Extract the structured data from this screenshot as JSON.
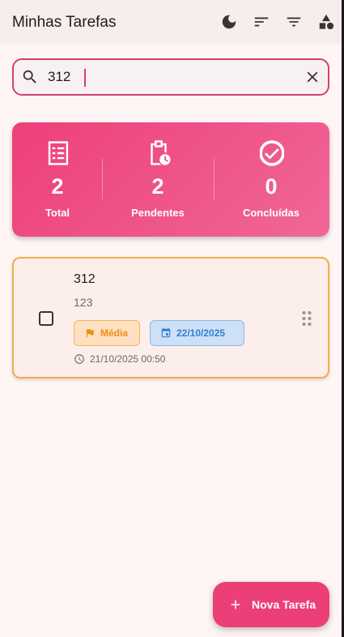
{
  "app": {
    "title": "Minhas Tarefas"
  },
  "appbar_actions": [
    {
      "icon": "dark-mode-icon"
    },
    {
      "icon": "sort-icon"
    },
    {
      "icon": "filter-icon"
    },
    {
      "icon": "category-icon"
    }
  ],
  "search": {
    "value": "312",
    "placeholder": ""
  },
  "stats": {
    "total": {
      "value": "2",
      "label": "Total"
    },
    "pending": {
      "value": "2",
      "label": "Pendentes"
    },
    "done": {
      "value": "0",
      "label": "Concluídas"
    }
  },
  "tasks": [
    {
      "title": "312",
      "description": "123",
      "priority": "Média",
      "due_date": "22/10/2025",
      "created_at": "21/10/2025 00:50",
      "completed": false
    }
  ],
  "fab": {
    "label": "Nova Tarefa"
  },
  "colors": {
    "accent": "#ec3f78",
    "priority_medium": "#f28c12",
    "due_date": "#2f7fd6",
    "card_border": "#f5ad4a"
  }
}
